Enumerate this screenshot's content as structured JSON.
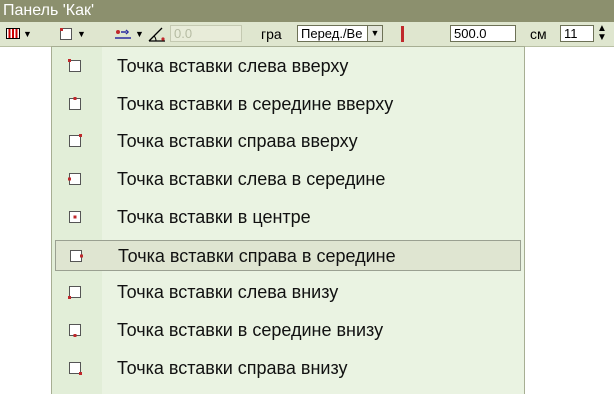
{
  "window": {
    "title": "Панель 'Как'"
  },
  "toolbar": {
    "angle_value": "0.0",
    "angle_unit": "гра",
    "view_select": "Перед./Ве",
    "length_value": "500.0",
    "length_unit": "см",
    "count_value": "11"
  },
  "menu": {
    "items": [
      {
        "label": "Точка вставки слева вверху",
        "icon": "insert-point-top-left-icon"
      },
      {
        "label": "Точка вставки в середине вверху",
        "icon": "insert-point-top-center-icon"
      },
      {
        "label": "Точка вставки справа вверху",
        "icon": "insert-point-top-right-icon"
      },
      {
        "label": "Точка вставки слева в середине",
        "icon": "insert-point-middle-left-icon"
      },
      {
        "label": "Точка вставки в центре",
        "icon": "insert-point-center-icon"
      },
      {
        "label": "Точка вставки справа в середине",
        "icon": "insert-point-middle-right-icon"
      },
      {
        "label": "Точка вставки слева внизу",
        "icon": "insert-point-bottom-left-icon"
      },
      {
        "label": "Точка вставки в середине внизу",
        "icon": "insert-point-bottom-center-icon"
      },
      {
        "label": "Точка вставки справа внизу",
        "icon": "insert-point-bottom-right-icon"
      }
    ],
    "highlighted_index": 5
  },
  "colors": {
    "title_bg": "#8c906e",
    "toolbar_bg": "#dfe6cf",
    "menu_bg": "#eaf3e2",
    "point_red": "#c0282b"
  }
}
